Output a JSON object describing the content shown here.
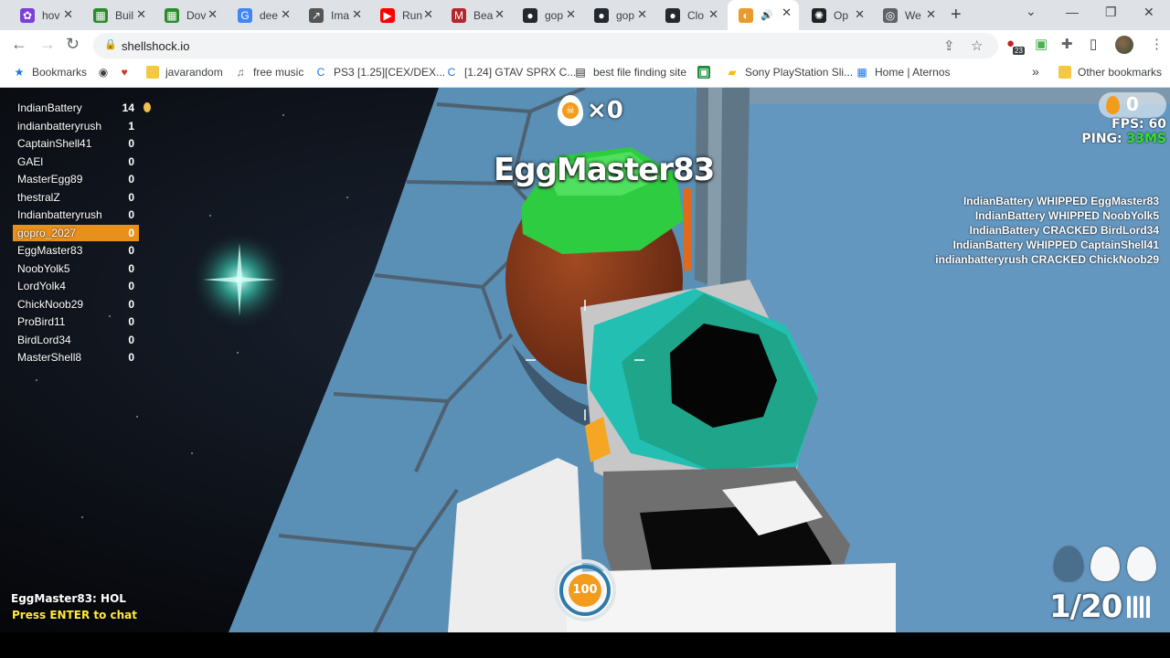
{
  "browser": {
    "tabs": [
      {
        "label": "hov",
        "icon": "multicolor-favicon-icon",
        "color": "#7b3fd8"
      },
      {
        "label": "Buil",
        "icon": "green-box-favicon-icon",
        "color": "#2c8c2c"
      },
      {
        "label": "Dov",
        "icon": "green-box-favicon-icon",
        "color": "#2c8c2c"
      },
      {
        "label": "dee",
        "icon": "google-icon",
        "color": "#4285f4"
      },
      {
        "label": "Ima",
        "icon": "chart-line-icon",
        "color": "#555555"
      },
      {
        "label": "Run",
        "icon": "youtube-icon",
        "color": "#ff0000"
      },
      {
        "label": "Bea",
        "icon": "m-icon",
        "color": "#b3262c"
      },
      {
        "label": "gop",
        "icon": "github-icon",
        "color": "#24292f"
      },
      {
        "label": "gop",
        "icon": "github-icon",
        "color": "#24292f"
      },
      {
        "label": "Clo",
        "icon": "github-icon",
        "color": "#24292f"
      },
      {
        "label": "",
        "icon": "shellshock-icon",
        "color": "#e89b2c",
        "active": true
      },
      {
        "label": "Op",
        "icon": "openai-icon",
        "color": "#202123"
      },
      {
        "label": "We",
        "icon": "globe-icon",
        "color": "#5f6368"
      }
    ],
    "url": "shellshock.io",
    "extension_badge": "23",
    "bookmarks": [
      {
        "label": "Bookmarks",
        "icon": "star-icon"
      },
      {
        "label": "",
        "icon": "globe-icon"
      },
      {
        "label": "",
        "icon": "heart-icon"
      },
      {
        "label": "javarandom",
        "icon": "folder-icon"
      },
      {
        "label": "free music",
        "icon": "music-icon"
      },
      {
        "label": "PS3 [1.25][CEX/DEX...",
        "icon": "c-icon"
      },
      {
        "label": "[1.24] GTAV SPRX C...",
        "icon": "c-icon"
      },
      {
        "label": "best file finding site",
        "icon": "file-icon"
      },
      {
        "label": "",
        "icon": "green-square-icon"
      },
      {
        "label": "Sony PlayStation Sli...",
        "icon": "bag-icon"
      },
      {
        "label": "Home | Aternos",
        "icon": "aternos-icon"
      }
    ],
    "other_bookmarks": "Other bookmarks",
    "more_bookmarks": "»"
  },
  "game": {
    "scoreboard": [
      {
        "name": "IndianBattery",
        "score": "14",
        "leader": true
      },
      {
        "name": "indianbatteryrush",
        "score": "1"
      },
      {
        "name": "CaptainShell41",
        "score": "0"
      },
      {
        "name": "GAEl",
        "score": "0"
      },
      {
        "name": "MasterEgg89",
        "score": "0"
      },
      {
        "name": "thestralZ",
        "score": "0"
      },
      {
        "name": "Indianbatteryrush",
        "score": "0"
      },
      {
        "name": "gopro_2027",
        "score": "0",
        "me": true
      },
      {
        "name": "EggMaster83",
        "score": "0"
      },
      {
        "name": "NoobYolk5",
        "score": "0"
      },
      {
        "name": "LordYolk4",
        "score": "0"
      },
      {
        "name": "ChickNoob29",
        "score": "0"
      },
      {
        "name": "ProBird11",
        "score": "0"
      },
      {
        "name": "BirdLord34",
        "score": "0"
      },
      {
        "name": "MasterShell8",
        "score": "0"
      }
    ],
    "kill_streak": "×0",
    "target_name": "EggMaster83",
    "eggs": "0",
    "fps_label": "FPS: 60",
    "ping_label": "PING:",
    "ping_value": "33MS",
    "ping_color": "#33e033",
    "killfeed": [
      "IndianBattery WHIPPED EggMaster83",
      "IndianBattery WHIPPED NoobYolk5",
      "IndianBattery CRACKED BirdLord34",
      "IndianBattery WHIPPED CaptainShell41",
      "indianbatteryrush CRACKED ChickNoob29"
    ],
    "chat_message": "EggMaster83: HOL",
    "chat_hint": "Press ENTER to chat",
    "chat_hint_color": "#ffea3a",
    "health": "100",
    "health_fraction": 1.0,
    "ammo": "1/20",
    "grenades": 3,
    "grenades_available": 2,
    "accent_colors": {
      "leader_row": "#e8901c",
      "player_green": "#2ecc40",
      "gun_teal": "#1fa58a"
    }
  }
}
